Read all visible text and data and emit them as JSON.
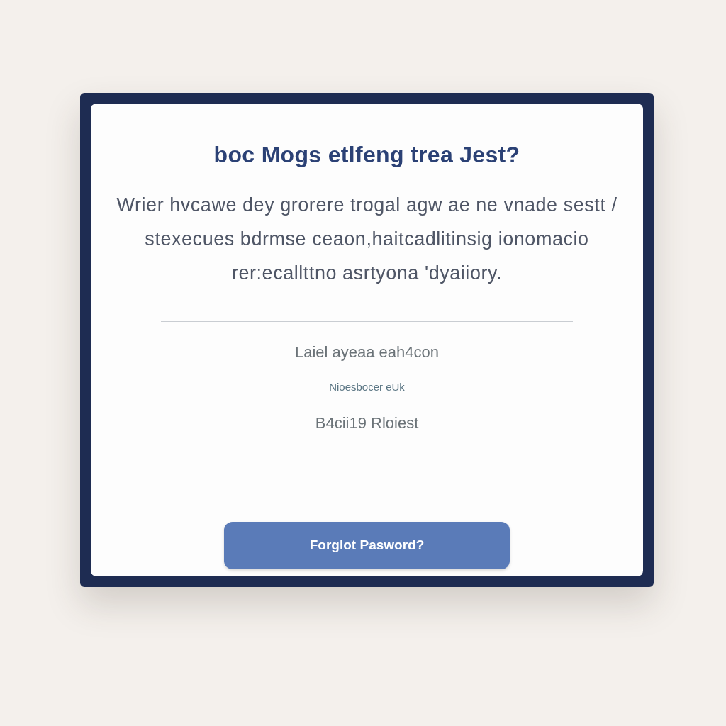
{
  "dialog": {
    "title": "boc Mogs etlfeng trea Jest?",
    "message_lines": [
      "Wrier hvcawe dey grorere trogal agw ae ne vnade sestt /",
      "stexecues bdrmse ceaon,haitcadlitinsig ionomacio",
      "rer:ecallttno asrtyona 'dyaiiory."
    ],
    "details": [
      {
        "kind": "text",
        "text": "Laiel ayeaa eah4con"
      },
      {
        "kind": "caption",
        "text": "Nioesbocer eUk"
      },
      {
        "kind": "text",
        "text": "B4cii19 Rloiest"
      }
    ],
    "button": {
      "label": "Forgiot Pasword?"
    }
  }
}
